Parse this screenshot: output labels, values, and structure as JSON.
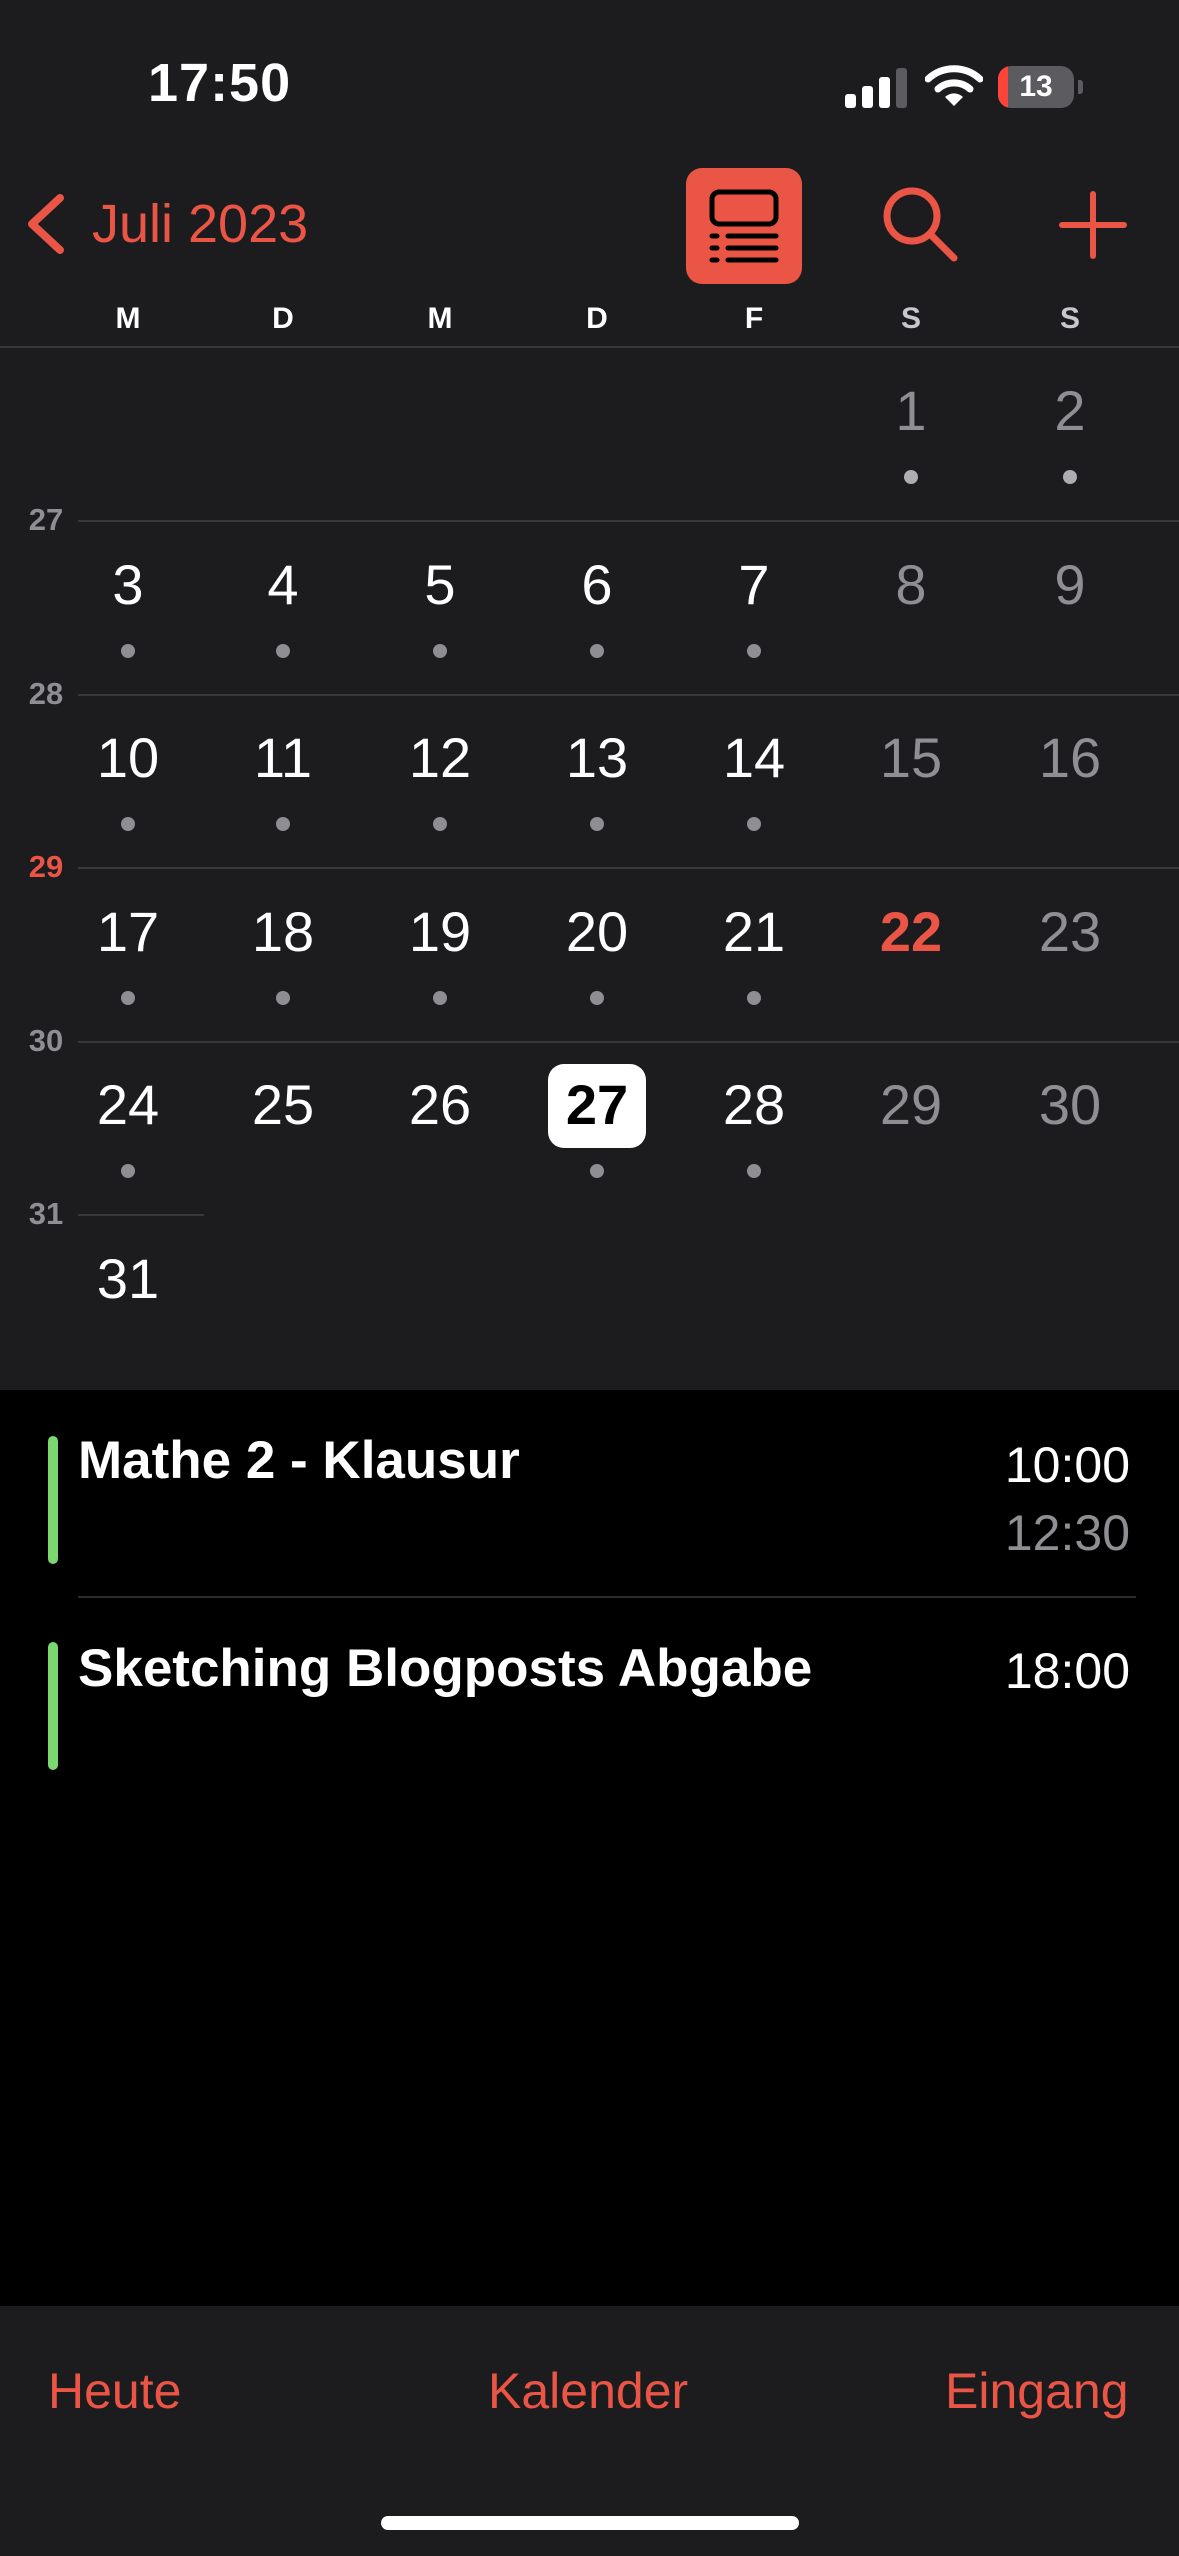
{
  "status_bar": {
    "time": "17:50",
    "battery": "13",
    "battery_level": 0.13
  },
  "nav": {
    "back_label": "Juli 2023"
  },
  "weekdays": [
    "M",
    "D",
    "M",
    "D",
    "F",
    "S",
    "S"
  ],
  "week_numbers": [
    "27",
    "28",
    "29",
    "30",
    "31"
  ],
  "current_week": "29",
  "days": [
    {
      "label": "1",
      "has_event": true
    },
    {
      "label": "2",
      "has_event": true
    },
    {
      "label": "3",
      "has_event": true
    },
    {
      "label": "4",
      "has_event": true
    },
    {
      "label": "5",
      "has_event": true
    },
    {
      "label": "6",
      "has_event": true
    },
    {
      "label": "7",
      "has_event": true
    },
    {
      "label": "8",
      "has_event": false
    },
    {
      "label": "9",
      "has_event": false
    },
    {
      "label": "10",
      "has_event": true
    },
    {
      "label": "11",
      "has_event": true
    },
    {
      "label": "12",
      "has_event": true
    },
    {
      "label": "13",
      "has_event": true
    },
    {
      "label": "14",
      "has_event": true
    },
    {
      "label": "15",
      "has_event": false
    },
    {
      "label": "16",
      "has_event": false
    },
    {
      "label": "17",
      "has_event": true
    },
    {
      "label": "18",
      "has_event": true
    },
    {
      "label": "19",
      "has_event": true
    },
    {
      "label": "20",
      "has_event": true
    },
    {
      "label": "21",
      "has_event": true
    },
    {
      "label": "22",
      "has_event": false,
      "today": true
    },
    {
      "label": "23",
      "has_event": false
    },
    {
      "label": "24",
      "has_event": true
    },
    {
      "label": "25",
      "has_event": false
    },
    {
      "label": "26",
      "has_event": false
    },
    {
      "label": "27",
      "has_event": true,
      "selected": true
    },
    {
      "label": "28",
      "has_event": true
    },
    {
      "label": "29",
      "has_event": false
    },
    {
      "label": "30",
      "has_event": false
    },
    {
      "label": "31",
      "has_event": false
    }
  ],
  "events": [
    {
      "title": "Mathe 2 - Klausur",
      "start": "10:00",
      "end": "12:30",
      "color": "#7bd870"
    },
    {
      "title": "Sketching Blogposts Abgabe",
      "start": "18:00",
      "end": "",
      "color": "#7bd870"
    }
  ],
  "tabs": {
    "today": "Heute",
    "calendars": "Kalender",
    "inbox": "Eingang"
  },
  "colors": {
    "accent": "#eb5545",
    "event_green": "#7bd870",
    "background": "#1c1c1e"
  }
}
